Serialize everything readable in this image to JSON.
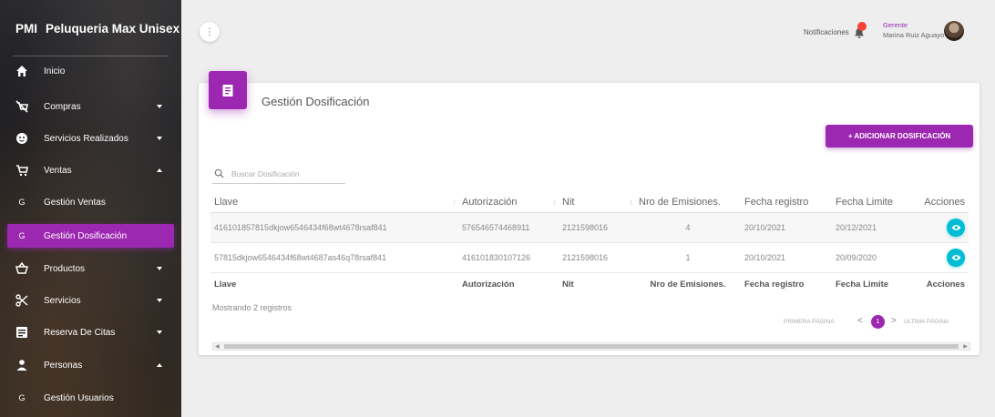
{
  "brand": {
    "abbr": "PMI",
    "name": "Peluqueria Max Unisex"
  },
  "sidebar": {
    "items": [
      {
        "label": "Inicio",
        "icon": "home-icon"
      },
      {
        "label": "Compras",
        "icon": "cart-off-icon"
      },
      {
        "label": "Servicios Realizados",
        "icon": "face-icon"
      },
      {
        "label": "Ventas",
        "icon": "cart-icon"
      },
      {
        "label": "Gestión Ventas",
        "letter": "G"
      },
      {
        "label": "Gestión Dosificación",
        "letter": "G",
        "active": true
      },
      {
        "label": "Productos",
        "icon": "basket-icon"
      },
      {
        "label": "Servicios",
        "icon": "scissors-icon"
      },
      {
        "label": "Reserva De Citas",
        "icon": "list-icon"
      },
      {
        "label": "Personas",
        "icon": "person-icon"
      },
      {
        "label": "Gestión Usuarios",
        "letter": "G"
      }
    ]
  },
  "topbar": {
    "menu_glyph": "⋮",
    "notifications_label": "Notificaciones",
    "user_role": "Gerente",
    "user_name": "Marina Ruiz Aguayo"
  },
  "card": {
    "title": "Gestión Dosificación",
    "add_button": "+ ADICIONAR DOSIFICACIÓN",
    "search_placeholder": "Buscar Dosificación"
  },
  "table": {
    "headers": [
      "Llave",
      "Autorización",
      "Nit",
      "Nro de Emisiones.",
      "Fecha registro",
      "Fecha Limite",
      "Acciones"
    ],
    "rows": [
      [
        "416101857815dkjow6546434f68wt4678rsaf841",
        "576546574468911",
        "2121598016",
        "4",
        "20/10/2021",
        "20/12/2021"
      ],
      [
        "57815dkjow6546434f68wt4687as46q78rsaf841",
        "416101830107126",
        "2121598016",
        "1",
        "20/10/2021",
        "20/09/2020"
      ]
    ],
    "footers": [
      "Llave",
      "Autorización",
      "Nit",
      "Nro de Emisiones.",
      "Fecha registro",
      "Fecha Limite",
      "Acciones"
    ]
  },
  "footer": {
    "showing": "Mostrando 2 registros",
    "first_page": "PRIMERA PÁGINA",
    "prev": "<",
    "current_page": "1",
    "next": ">",
    "last_page": "ÚLTIMA PÁGINA"
  },
  "colors": {
    "accent": "#9c27b0",
    "info": "#00bcd4",
    "badge": "#f44336"
  }
}
